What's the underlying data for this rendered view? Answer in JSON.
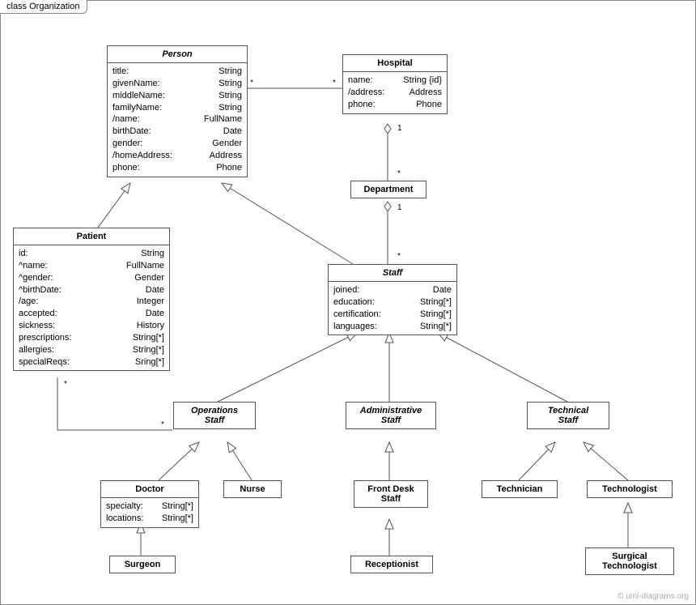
{
  "frame": {
    "title": "class Organization"
  },
  "credit": "© uml-diagrams.org",
  "classes": {
    "person": {
      "name": "Person",
      "attrs": [
        [
          "title:",
          "String"
        ],
        [
          "givenName:",
          "String"
        ],
        [
          "middleName:",
          "String"
        ],
        [
          "familyName:",
          "String"
        ],
        [
          "/name:",
          "FullName"
        ],
        [
          "birthDate:",
          "Date"
        ],
        [
          "gender:",
          "Gender"
        ],
        [
          "/homeAddress:",
          "Address"
        ],
        [
          "phone:",
          "Phone"
        ]
      ]
    },
    "hospital": {
      "name": "Hospital",
      "attrs": [
        [
          "name:",
          "String {id}"
        ],
        [
          "/address:",
          "Address"
        ],
        [
          "phone:",
          "Phone"
        ]
      ]
    },
    "department": {
      "name": "Department"
    },
    "patient": {
      "name": "Patient",
      "attrs": [
        [
          "id:",
          "String"
        ],
        [
          "^name:",
          "FullName"
        ],
        [
          "^gender:",
          "Gender"
        ],
        [
          "^birthDate:",
          "Date"
        ],
        [
          "/age:",
          "Integer"
        ],
        [
          "accepted:",
          "Date"
        ],
        [
          "sickness:",
          "History"
        ],
        [
          "prescriptions:",
          "String[*]"
        ],
        [
          "allergies:",
          "String[*]"
        ],
        [
          "specialReqs:",
          "Sring[*]"
        ]
      ]
    },
    "staff": {
      "name": "Staff",
      "attrs": [
        [
          "joined:",
          "Date"
        ],
        [
          "education:",
          "String[*]"
        ],
        [
          "certification:",
          "String[*]"
        ],
        [
          "languages:",
          "String[*]"
        ]
      ]
    },
    "opsStaff": {
      "name": "Operations\nStaff"
    },
    "adminStaff": {
      "name": "Administrative\nStaff"
    },
    "techStaff": {
      "name": "Technical\nStaff"
    },
    "doctor": {
      "name": "Doctor",
      "attrs": [
        [
          "specialty:",
          "String[*]"
        ],
        [
          "locations:",
          "String[*]"
        ]
      ]
    },
    "nurse": {
      "name": "Nurse"
    },
    "frontDesk": {
      "name": "Front Desk\nStaff"
    },
    "technician": {
      "name": "Technician"
    },
    "technologist": {
      "name": "Technologist"
    },
    "surgeon": {
      "name": "Surgeon"
    },
    "receptionist": {
      "name": "Receptionist"
    },
    "surgicalTech": {
      "name": "Surgical\nTechnologist"
    }
  },
  "mult": {
    "ph1": "*",
    "ph2": "*",
    "hd1": "1",
    "hd2": "*",
    "ds1": "1",
    "ds2": "*",
    "ps1": "*",
    "ps2": "*"
  }
}
